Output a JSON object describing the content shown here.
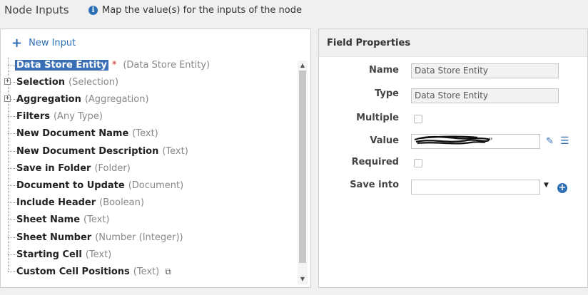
{
  "header": {
    "title": "Node Inputs",
    "info_text": "Map the value(s) for the inputs of the node"
  },
  "left_panel": {
    "new_input_label": "New Input",
    "tree": [
      {
        "name": "Data Store Entity",
        "type": "(Data Store Entity)",
        "selected": true,
        "required": true,
        "expandable": false
      },
      {
        "name": "Selection",
        "type": "(Selection)",
        "expandable": true
      },
      {
        "name": "Aggregation",
        "type": "(Aggregation)",
        "expandable": true
      },
      {
        "name": "Filters",
        "type": "(Any Type)"
      },
      {
        "name": "New Document Name",
        "type": "(Text)"
      },
      {
        "name": "New Document Description",
        "type": "(Text)"
      },
      {
        "name": "Save in Folder",
        "type": "(Folder)"
      },
      {
        "name": "Document to Update",
        "type": "(Document)"
      },
      {
        "name": "Include Header",
        "type": "(Boolean)"
      },
      {
        "name": "Sheet Name",
        "type": "(Text)"
      },
      {
        "name": "Sheet Number",
        "type": "(Number (Integer))"
      },
      {
        "name": "Starting Cell",
        "type": "(Text)"
      },
      {
        "name": "Custom Cell Positions",
        "type": "(Text)",
        "copy_icon": true
      }
    ],
    "required_marker": "*"
  },
  "field_properties": {
    "title": "Field Properties",
    "name_label": "Name",
    "name_value": "Data Store Entity",
    "type_label": "Type",
    "type_value": "Data Store Entity",
    "multiple_label": "Multiple",
    "multiple_checked": false,
    "value_label": "Value",
    "value_trailing": "\"",
    "required_label": "Required",
    "required_checked": false,
    "save_into_label": "Save into",
    "save_into_value": ""
  },
  "icons": {
    "info": "info-icon",
    "new_input": "plus-icon",
    "edit": "edit-icon",
    "list": "list-icon",
    "add": "add-circle-icon",
    "copy": "copy-icon"
  },
  "colors": {
    "accent": "#2e6fb5",
    "selection": "#3b6fb5",
    "required": "#cc2222"
  }
}
